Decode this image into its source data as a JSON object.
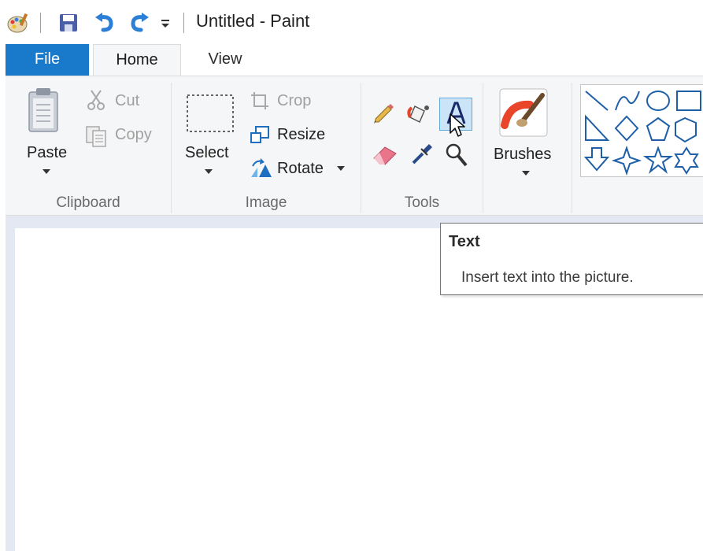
{
  "window": {
    "title": "Untitled - Paint"
  },
  "quick_access": {
    "app_icon": "paint-palette-icon",
    "save_icon": "save-icon",
    "undo_icon": "undo-icon",
    "redo_icon": "redo-icon",
    "customize_icon": "customize-dropdown-icon"
  },
  "tabs": [
    {
      "label": "File",
      "active": false
    },
    {
      "label": "Home",
      "active": true
    },
    {
      "label": "View",
      "active": false
    }
  ],
  "ribbon": {
    "clipboard": {
      "label": "Clipboard",
      "paste_label": "Paste",
      "cut_label": "Cut",
      "copy_label": "Copy"
    },
    "image": {
      "label": "Image",
      "select_label": "Select",
      "crop_label": "Crop",
      "resize_label": "Resize",
      "rotate_label": "Rotate"
    },
    "tools": {
      "label": "Tools",
      "items": [
        "pencil-icon",
        "fill-bucket-icon",
        "text-icon",
        "eraser-icon",
        "color-picker-icon",
        "magnifier-icon"
      ],
      "hovered": "text-icon"
    },
    "brushes": {
      "label": "Brushes"
    },
    "shapes": {
      "items": [
        "line-icon",
        "curve-icon",
        "oval-icon",
        "rectangle-icon",
        "right-triangle-icon",
        "diamond-icon",
        "pentagon-icon",
        "hexagon-icon",
        "down-arrow-icon",
        "four-point-star-icon",
        "five-point-star-icon",
        "six-point-star-icon"
      ]
    }
  },
  "tooltip": {
    "title": "Text",
    "description": "Insert text into the picture."
  },
  "colors": {
    "file_tab": "#1979ca",
    "ribbon_bg": "#f5f6f7",
    "workspace_bg": "#e3e8f2",
    "highlight": "#cce4f7"
  }
}
